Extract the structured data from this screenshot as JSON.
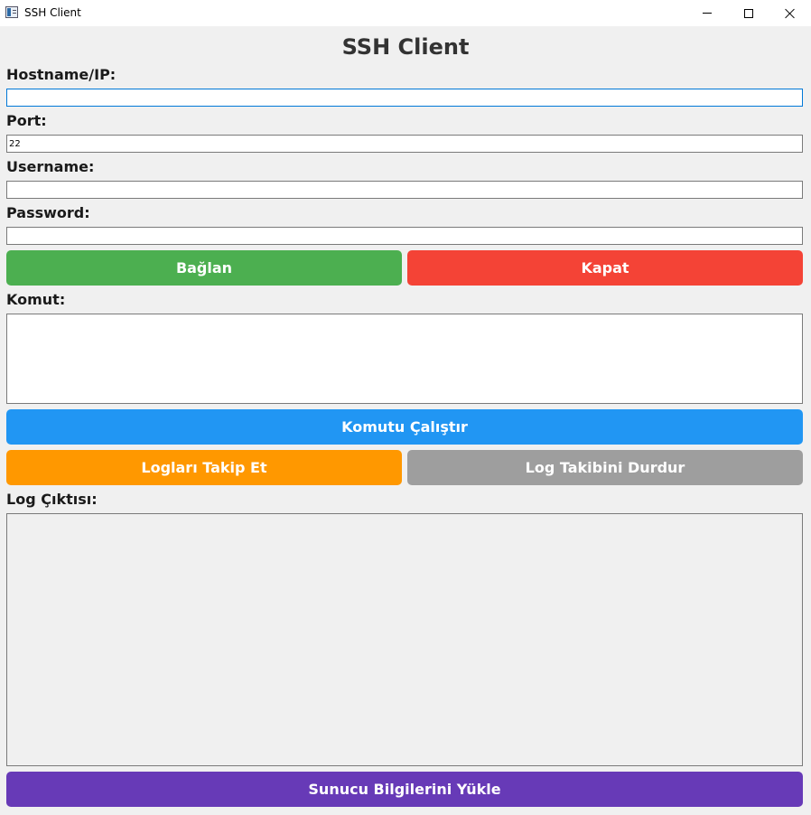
{
  "window": {
    "title": "SSH Client"
  },
  "app": {
    "title": "SSH Client"
  },
  "form": {
    "hostname_label": "Hostname/IP:",
    "hostname_value": "",
    "port_label": "Port:",
    "port_value": "22",
    "username_label": "Username:",
    "username_value": "",
    "password_label": "Password:",
    "password_value": ""
  },
  "buttons": {
    "connect": "Bağlan",
    "close": "Kapat",
    "run_command": "Komutu Çalıştır",
    "follow_logs": "Logları Takip Et",
    "stop_follow": "Log Takibini Durdur",
    "load_server_info": "Sunucu Bilgilerini Yükle"
  },
  "command": {
    "label": "Komut:",
    "value": ""
  },
  "log": {
    "label": "Log Çıktısı:",
    "value": ""
  },
  "colors": {
    "connect": "#4caf50",
    "close": "#f44336",
    "run_command": "#2196f3",
    "follow_logs": "#ff9800",
    "stop_follow": "#9e9e9e",
    "load_server_info": "#673ab7"
  }
}
